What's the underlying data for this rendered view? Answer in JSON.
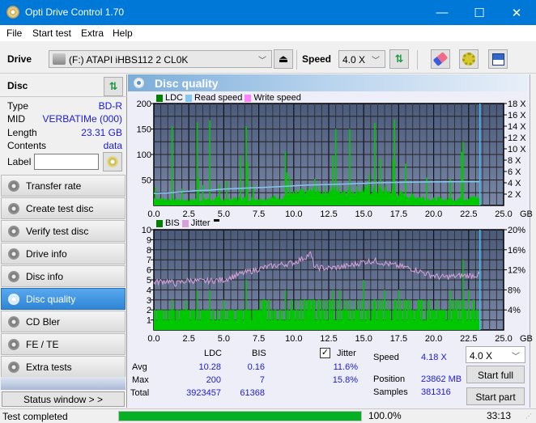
{
  "window": {
    "title": "Opti Drive Control 1.70",
    "minimize": "—",
    "maximize": "☐",
    "close": "✕"
  },
  "menu": [
    "File",
    "Start test",
    "Extra",
    "Help"
  ],
  "toolbar": {
    "drive_label": "Drive",
    "drive_value": "(F:)  ATAPI iHBS112  2 CL0K",
    "speed_label": "Speed",
    "speed_value": "4.0 X",
    "eject_icon": "⏏",
    "refresh_icon": "⇅",
    "erase_icon": "eraser",
    "settings_icon": "gears",
    "save_icon": "floppy"
  },
  "disc": {
    "header": "Disc",
    "rows": [
      {
        "key": "Type",
        "value": "BD-R"
      },
      {
        "key": "MID",
        "value": "VERBATIMe (000)"
      },
      {
        "key": "Length",
        "value": "23.31 GB"
      },
      {
        "key": "Contents",
        "value": "data"
      }
    ],
    "label_key": "Label",
    "label_value": ""
  },
  "nav": [
    {
      "label": "Transfer rate",
      "active": false
    },
    {
      "label": "Create test disc",
      "active": false
    },
    {
      "label": "Verify test disc",
      "active": false
    },
    {
      "label": "Drive info",
      "active": false
    },
    {
      "label": "Disc info",
      "active": false
    },
    {
      "label": "Disc quality",
      "active": true
    },
    {
      "label": "CD Bler",
      "active": false
    },
    {
      "label": "FE / TE",
      "active": false
    },
    {
      "label": "Extra tests",
      "active": false
    }
  ],
  "status_window_button": "Status window > >",
  "panel_title": "Disc quality",
  "colors": {
    "ldc": "#00c800",
    "ldc_legend": "#008000",
    "read_speed": "#80c8f0",
    "write_speed": "#ff80ff",
    "jitter": "#d8a0d8",
    "bis": "#00c800",
    "marker": "#40c0f0",
    "plot_top": "#4a5a7a",
    "plot_bottom": "#7a88a8"
  },
  "chart_data": [
    {
      "type": "bar",
      "title": "LDC / Read speed",
      "legend": [
        "LDC",
        "Read speed",
        "Write speed"
      ],
      "xlabel": "GB",
      "x_ticks": [
        "0.0",
        "2.5",
        "5.0",
        "7.5",
        "10.0",
        "12.5",
        "15.0",
        "17.5",
        "20.0",
        "22.5",
        "25.0"
      ],
      "xlim": [
        0,
        25
      ],
      "ylim": [
        0,
        200
      ],
      "y_ticks": [
        50,
        100,
        150,
        200
      ],
      "y2lim": [
        0,
        18
      ],
      "y2_ticks": [
        "2 X",
        "4 X",
        "6 X",
        "8 X",
        "10 X",
        "12 X",
        "14 X",
        "16 X",
        "18 X"
      ],
      "end_marker_gb": 23.31,
      "ldc_baseline": [
        [
          0,
          15
        ],
        [
          2.5,
          12
        ],
        [
          5,
          14
        ],
        [
          7.5,
          15
        ],
        [
          9,
          18
        ],
        [
          10,
          24
        ],
        [
          11,
          30
        ],
        [
          12.5,
          33
        ],
        [
          15,
          34
        ],
        [
          16.5,
          33
        ],
        [
          17.5,
          25
        ],
        [
          19,
          18
        ],
        [
          20,
          14
        ],
        [
          21.5,
          14
        ],
        [
          23.3,
          18
        ]
      ],
      "ldc_spikes": [
        [
          0.1,
          35
        ],
        [
          1.3,
          155
        ],
        [
          2,
          33
        ],
        [
          3.1,
          163
        ],
        [
          3.2,
          55
        ],
        [
          3.5,
          40
        ],
        [
          4,
          167
        ],
        [
          4.7,
          42
        ],
        [
          5.2,
          48
        ],
        [
          6.2,
          97
        ],
        [
          6.6,
          155
        ],
        [
          6.7,
          85
        ],
        [
          7.1,
          40
        ],
        [
          9.4,
          105
        ],
        [
          9.5,
          65
        ],
        [
          9.7,
          58
        ],
        [
          11.5,
          52
        ],
        [
          12.8,
          98
        ],
        [
          13,
          150
        ],
        [
          14,
          150
        ],
        [
          15.4,
          62
        ],
        [
          15.8,
          162
        ],
        [
          16.2,
          92
        ],
        [
          17.2,
          168
        ],
        [
          17.1,
          90
        ],
        [
          18,
          82
        ],
        [
          19.5,
          55
        ],
        [
          21.2,
          52
        ],
        [
          22.1,
          125
        ],
        [
          22.0,
          105
        ]
      ],
      "read_speed": [
        [
          0,
          2.1
        ],
        [
          1,
          2.2
        ],
        [
          2,
          2.4
        ],
        [
          3,
          2.6
        ],
        [
          4,
          2.7
        ],
        [
          5,
          2.9
        ],
        [
          6,
          3.0
        ],
        [
          7,
          3.1
        ],
        [
          8,
          3.2
        ],
        [
          9.5,
          3.4
        ],
        [
          11,
          3.6
        ],
        [
          12.5,
          3.7
        ],
        [
          14,
          3.8
        ],
        [
          16,
          4.0
        ],
        [
          18,
          4.1
        ],
        [
          20,
          4.15
        ],
        [
          22,
          4.2
        ],
        [
          23.3,
          4.2
        ]
      ]
    },
    {
      "type": "bar",
      "title": "BIS / Jitter",
      "legend": [
        "BIS",
        "Jitter"
      ],
      "xlabel": "GB",
      "x_ticks": [
        "0.0",
        "2.5",
        "5.0",
        "7.5",
        "10.0",
        "12.5",
        "15.0",
        "17.5",
        "20.0",
        "22.5",
        "25.0"
      ],
      "xlim": [
        0,
        25
      ],
      "ylim": [
        0,
        10
      ],
      "y_ticks": [
        1,
        2,
        3,
        4,
        5,
        6,
        7,
        8,
        9,
        10
      ],
      "y2lim": [
        0,
        20
      ],
      "y2_ticks": [
        "4%",
        "8%",
        "12%",
        "16%",
        "20%"
      ],
      "end_marker_gb": 23.31,
      "bis_spikes": [
        [
          1.3,
          3
        ],
        [
          2.3,
          3
        ],
        [
          3.1,
          4
        ],
        [
          4,
          4
        ],
        [
          5,
          3
        ],
        [
          6.6,
          5
        ],
        [
          8,
          3
        ],
        [
          9.4,
          4
        ],
        [
          10.5,
          3
        ],
        [
          11,
          3
        ],
        [
          11.8,
          3
        ],
        [
          12.8,
          4
        ],
        [
          13.3,
          4
        ],
        [
          14,
          3
        ],
        [
          15,
          5
        ],
        [
          15.8,
          3
        ],
        [
          16.5,
          4
        ],
        [
          17.5,
          4
        ],
        [
          18,
          3
        ],
        [
          19,
          3
        ],
        [
          21.2,
          4
        ],
        [
          22.1,
          7
        ],
        [
          22.5,
          4
        ]
      ],
      "jitter": [
        [
          0,
          9.5
        ],
        [
          1,
          9.8
        ],
        [
          1.5,
          9.2
        ],
        [
          2.5,
          9.9
        ],
        [
          3.5,
          9.7
        ],
        [
          5,
          10
        ],
        [
          6,
          11
        ],
        [
          7,
          11.8
        ],
        [
          8,
          12.5
        ],
        [
          9,
          13
        ],
        [
          10,
          13.4
        ],
        [
          10.8,
          14.5
        ],
        [
          11.2,
          15.2
        ],
        [
          11.5,
          12.5
        ],
        [
          12.5,
          12.3
        ],
        [
          14,
          12.8
        ],
        [
          15,
          13.6
        ],
        [
          15.8,
          13.8
        ],
        [
          17,
          13
        ],
        [
          18.5,
          12.2
        ],
        [
          19.5,
          11.2
        ],
        [
          20.5,
          10.5
        ],
        [
          22,
          10.8
        ],
        [
          23.3,
          11
        ]
      ]
    }
  ],
  "stats": {
    "col_ldc": "LDC",
    "col_bis": "BIS",
    "jitter_label": "Jitter",
    "jitter_checked": true,
    "rows": [
      {
        "label": "Avg",
        "ldc": "10.28",
        "bis": "0.16",
        "jitter": "11.6%"
      },
      {
        "label": "Max",
        "ldc": "200",
        "bis": "7",
        "jitter": "15.8%"
      },
      {
        "label": "Total",
        "ldc": "3923457",
        "bis": "61368",
        "jitter": ""
      }
    ],
    "speed_label": "Speed",
    "speed_value": "4.18 X",
    "position_label": "Position",
    "position_value": "23862 MB",
    "samples_label": "Samples",
    "samples_value": "381316",
    "speed_select": "4.0 X",
    "start_full": "Start full",
    "start_part": "Start part"
  },
  "status": {
    "text": "Test completed",
    "progress": 100.0,
    "progress_label": "100.0%",
    "time": "33:13"
  }
}
